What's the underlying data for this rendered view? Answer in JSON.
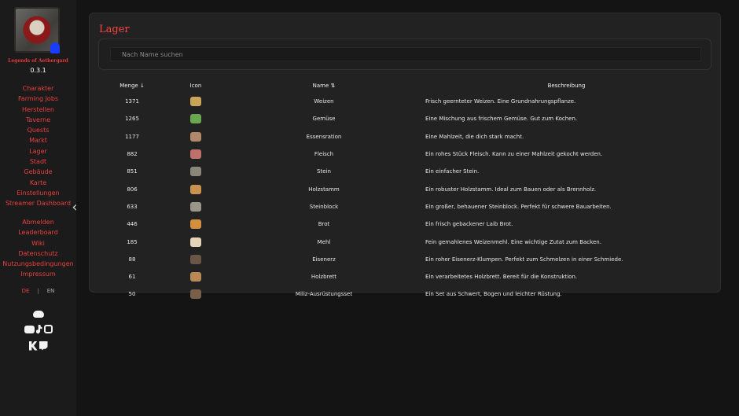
{
  "sidebar": {
    "game_title": "Legends of Aethergard",
    "version": "0.3.1",
    "nav": [
      "Charakter",
      "Farming Jobs",
      "Herstellen",
      "Taverne",
      "Quests",
      "Markt",
      "Lager",
      "Stadt",
      "Gebäude",
      "Karte",
      "Einstellungen",
      "Streamer Dashboard"
    ],
    "nav2": [
      "Abmelden",
      "Leaderboard",
      "Wiki",
      "Datenschutz",
      "Nutzungsbedingungen",
      "Impressum"
    ],
    "lang": {
      "de": "DE",
      "sep": "|",
      "en": "EN"
    },
    "icons": [
      "discord-icon",
      "youtube-icon",
      "tiktok-icon",
      "instagram-icon",
      "kick-icon",
      "twitch-icon"
    ],
    "collapse_icon": "‹"
  },
  "main": {
    "title": "Lager",
    "search_placeholder": "Nach Name suchen",
    "columns": {
      "menge": "Menge ↓",
      "icon": "Icon",
      "name": "Name ⇅",
      "desc": "Beschreibung"
    },
    "rows": [
      {
        "menge": "1371",
        "name": "Weizen",
        "desc": "Frisch geernteter Weizen. Eine Grundnahrungspflanze.",
        "color": "#c9a55a"
      },
      {
        "menge": "1265",
        "name": "Gemüse",
        "desc": "Eine Mischung aus frischem Gemüse. Gut zum Kochen.",
        "color": "#6aa84f"
      },
      {
        "menge": "1177",
        "name": "Essensration",
        "desc": "Eine Mahlzeit, die dich stark macht.",
        "color": "#b08a6a"
      },
      {
        "menge": "882",
        "name": "Fleisch",
        "desc": "Ein rohes Stück Fleisch. Kann zu einer Mahlzeit gekocht werden.",
        "color": "#c0706a"
      },
      {
        "menge": "851",
        "name": "Stein",
        "desc": "Ein einfacher Stein.",
        "color": "#8a867c"
      },
      {
        "menge": "806",
        "name": "Holzstamm",
        "desc": "Ein robuster Holzstamm. Ideal zum Bauen oder als Brennholz.",
        "color": "#c9924f"
      },
      {
        "menge": "633",
        "name": "Steinblock",
        "desc": "Ein großer, behauener Steinblock. Perfekt für schwere Bauarbeiten.",
        "color": "#9a958a"
      },
      {
        "menge": "446",
        "name": "Brot",
        "desc": "Ein frisch gebackener Laib Brot.",
        "color": "#d28f3e"
      },
      {
        "menge": "185",
        "name": "Mehl",
        "desc": "Fein gemahlenes Weizenmehl. Eine wichtige Zutat zum Backen.",
        "color": "#e3d3b8"
      },
      {
        "menge": "88",
        "name": "Eisenerz",
        "desc": "Ein roher Eisenerz-Klumpen. Perfekt zum Schmelzen in einer Schmiede.",
        "color": "#6b5646"
      },
      {
        "menge": "61",
        "name": "Holzbrett",
        "desc": "Ein verarbeitetes Holzbrett. Bereit für die Konstruktion.",
        "color": "#b98a55"
      },
      {
        "menge": "50",
        "name": "Miliz-Ausrüstungsset",
        "desc": "Ein Set aus Schwert, Bogen und leichter Rüstung.",
        "color": "#7a5f48"
      }
    ]
  }
}
